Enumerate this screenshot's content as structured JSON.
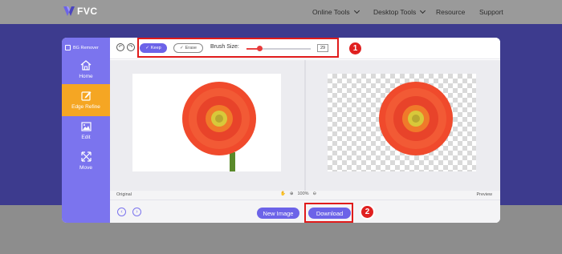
{
  "brand": {
    "name": "FVC"
  },
  "nav": {
    "items": [
      {
        "label": "Online Tools"
      },
      {
        "label": "Desktop Tools"
      },
      {
        "label": "Resource"
      },
      {
        "label": "Support"
      }
    ]
  },
  "sidebar": {
    "title": "BG Remover",
    "items": [
      {
        "label": "Home",
        "icon": "home-icon"
      },
      {
        "label": "Edge Refine",
        "icon": "edit-square-icon",
        "active": true
      },
      {
        "label": "Edit",
        "icon": "image-icon"
      },
      {
        "label": "Move",
        "icon": "move-icon"
      }
    ]
  },
  "toolbar": {
    "keep_label": "Keep",
    "erase_label": "Erase",
    "brush_label": "Brush Size:",
    "brush_value": "29",
    "brush_fraction": 0.2
  },
  "status": {
    "original_label": "Original",
    "zoom": "100%",
    "preview_label": "Preview"
  },
  "actions": {
    "new_image_label": "New Image",
    "download_label": "Download"
  },
  "callouts": [
    {
      "number": "1"
    },
    {
      "number": "2"
    }
  ],
  "colors": {
    "accent": "#6c63e8",
    "sidebar": "#7b74ee",
    "active_tab": "#f5a623",
    "highlight": "#e01b1b",
    "hero_band": "#3d3b8e"
  }
}
